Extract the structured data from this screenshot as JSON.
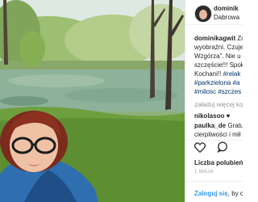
{
  "post": {
    "username": "dominik",
    "location": "Dabrowa",
    "caption": {
      "author": "dominikagwit",
      "lines": [
        "Zo",
        "wyobraźni. Czuje",
        "Wzgórza\". Nie u",
        "szczęście!!! Spok",
        "Kochani!! "
      ],
      "line5_tag": "#relak",
      "tag_lines": [
        "#parkzielona #a",
        "#milosc #szczes"
      ]
    },
    "load_more": "załaduj więcej ko",
    "comments": [
      {
        "author": "nikolasoo",
        "text": "♥"
      },
      {
        "author": "paulka_de",
        "text": "Gratu",
        "cont": "cierpliwości i mił"
      }
    ],
    "likes": "Liczba polubień:",
    "date": "1 MAJA",
    "login": {
      "link": "Zaloguj się",
      "rest": ", by c"
    },
    "icons": {
      "like": "heart-icon",
      "comment": "comment-icon"
    }
  }
}
